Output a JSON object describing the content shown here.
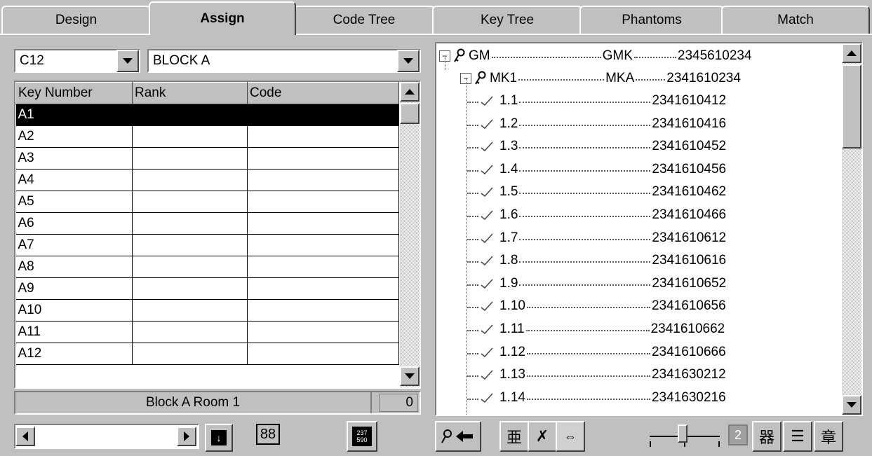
{
  "tabs": [
    {
      "label": "Design"
    },
    {
      "label": "Assign"
    },
    {
      "label": "Code Tree"
    },
    {
      "label": "Key Tree"
    },
    {
      "label": "Phantoms"
    },
    {
      "label": "Match"
    }
  ],
  "left": {
    "key_combo": {
      "value": "C12"
    },
    "block_combo": {
      "value": "BLOCK A"
    },
    "grid": {
      "columns": [
        "Key Number",
        "Rank",
        "Code"
      ],
      "rows": [
        "A1",
        "A2",
        "A3",
        "A4",
        "A5",
        "A6",
        "A7",
        "A8",
        "A9",
        "A10",
        "A11",
        "A12"
      ]
    },
    "status": {
      "room": "Block A Room 1",
      "count": "0"
    }
  },
  "tree": {
    "root": {
      "name": "GM",
      "code": "GMK",
      "number": "2345610234"
    },
    "child": {
      "name": "MK1",
      "code": "MKA",
      "number": "2341610234"
    },
    "items": [
      {
        "label": "1.1",
        "number": "2341610412"
      },
      {
        "label": "1.2",
        "number": "2341610416"
      },
      {
        "label": "1.3",
        "number": "2341610452"
      },
      {
        "label": "1.4",
        "number": "2341610456"
      },
      {
        "label": "1.5",
        "number": "2341610462"
      },
      {
        "label": "1.6",
        "number": "2341610466"
      },
      {
        "label": "1.7",
        "number": "2341610612"
      },
      {
        "label": "1.8",
        "number": "2341610616"
      },
      {
        "label": "1.9",
        "number": "2341610652"
      },
      {
        "label": "1.10",
        "number": "2341610656"
      },
      {
        "label": "1.11",
        "number": "2341610662"
      },
      {
        "label": "1.12",
        "number": "2341610666"
      },
      {
        "label": "1.13",
        "number": "2341630212"
      },
      {
        "label": "1.14",
        "number": "2341630216"
      }
    ]
  },
  "toolbar": {
    "counter_value": "2",
    "code_icon_text": "237 590"
  },
  "icons": {
    "key": "key-icon",
    "check": "check-icon",
    "collapse": "minus-box-icon"
  }
}
